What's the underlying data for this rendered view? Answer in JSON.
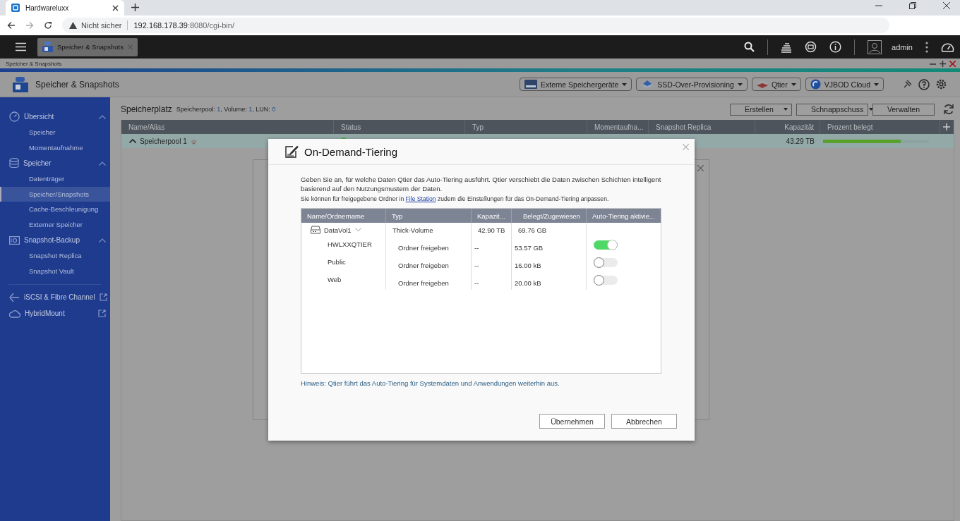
{
  "browser": {
    "tab_title": "Hardwareluxx",
    "security": "Nicht sicher",
    "url_host": "192.168.178.39",
    "url_rest": ":8080/cgi-bin/"
  },
  "app_bar": {
    "open_app": "Speicher & Snapshots",
    "user": "admin"
  },
  "window": {
    "strip_title": "Speicher & Snapshots",
    "title": "Speicher & Snapshots"
  },
  "toolbar": [
    {
      "label": "Externe Speichergeräte",
      "kind": "drive"
    },
    {
      "label": "SSD-Over-Provisioning",
      "kind": "ssd"
    },
    {
      "label": "Qtier",
      "kind": "tier"
    },
    {
      "label": "VJBOD Cloud",
      "kind": "cloud"
    }
  ],
  "sidebar": [
    {
      "label": "Übersicht",
      "kind": "gauge",
      "expanded": true,
      "children": [
        {
          "label": "Speicher",
          "selected": false
        },
        {
          "label": "Momentaufnahme",
          "selected": false
        }
      ]
    },
    {
      "label": "Speicher",
      "kind": "database",
      "expanded": true,
      "children": [
        {
          "label": "Datenträger",
          "selected": false
        },
        {
          "label": "Speicher/Snapshots",
          "selected": true
        },
        {
          "label": "Cache-Beschleunigung",
          "selected": false
        },
        {
          "label": "Externer Speicher",
          "selected": false
        }
      ]
    },
    {
      "label": "Snapshot-Backup",
      "kind": "camera",
      "expanded": true,
      "children": [
        {
          "label": "Snapshot Replica",
          "selected": false
        },
        {
          "label": "Snapshot Vault",
          "selected": false
        }
      ]
    }
  ],
  "sidebar_links": [
    {
      "label": "iSCSI & Fibre Channel",
      "kind": "share"
    },
    {
      "label": "HybridMount",
      "kind": "cloud"
    }
  ],
  "main": {
    "heading": "Speicherplatz",
    "summary": [
      {
        "label": "Speicherpool:",
        "value": "1"
      },
      {
        "label": ", Volume:",
        "value": "1"
      },
      {
        "label": ", LUN:",
        "value": "0"
      }
    ],
    "actions": [
      {
        "label": "Erstellen",
        "menu": true
      },
      {
        "label": "Schnappschuss",
        "menu": true
      },
      {
        "label": "Verwalten",
        "menu": false
      }
    ],
    "columns": [
      "Name/Alias",
      "Status",
      "Typ",
      "Momentaufna...",
      "Snapshot Replica",
      "Kapazität",
      "Prozent belegt"
    ],
    "rows": [
      {
        "name": "Speicherpool 1",
        "color": "#4caf50",
        "capacity": "43.29 TB",
        "level": 0.73
      }
    ]
  },
  "dialog": {
    "title": "On-Demand-Tiering",
    "intro": "Geben Sie an, für welche Daten Qtier das Auto-Tiering ausführt. Qtier verschiebt die Daten zwischen Schichten intelligent basierend auf den Nutzungsmustern der Daten.",
    "note_before": "Sie können für freigegebene Ordner in",
    "note_link": "File Station",
    "note_after": "zudem die Einstellungen für das On-Demand-Tiering anpassen.",
    "columns": [
      "Name/Ordnername",
      "Typ",
      "Kapazit...",
      "Belegt/Zugewiesen",
      "Auto-Tiering aktivie..."
    ],
    "volumes": [
      {
        "name": "DataVol1",
        "type": "Thick-Volume",
        "capacity": "42.90 TB",
        "used": "69.76 GB",
        "expanded": true,
        "children": [
          {
            "name": "HWLXXQTIER",
            "type": "Ordner freigeben",
            "capacity": "--",
            "used": "53.57 GB",
            "on": true
          },
          {
            "name": "Public",
            "type": "Ordner freigeben",
            "capacity": "--",
            "used": "16.00 kB",
            "on": false
          },
          {
            "name": "Web",
            "type": "Ordner freigeben",
            "capacity": "--",
            "used": "20.00 kB",
            "on": false
          }
        ]
      }
    ],
    "hint": "Hinweis: Qtier führt das Auto-Tiering für Systemdaten und Anwendungen weiterhin aus.",
    "buttons": [
      "Übernehmen",
      "Abbrechen"
    ]
  }
}
